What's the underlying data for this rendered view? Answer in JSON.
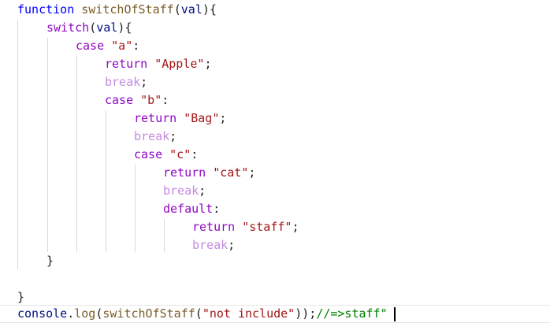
{
  "editor": {
    "lines": [
      {
        "tokens": [
          [
            "kw",
            "function"
          ],
          [
            "plain",
            " "
          ],
          [
            "fn",
            "switchOfStaff"
          ],
          [
            "plain",
            "("
          ],
          [
            "ident",
            "val"
          ],
          [
            "plain",
            "){"
          ]
        ]
      },
      {
        "tokens": [
          [
            "ctrl",
            "switch"
          ],
          [
            "plain",
            "("
          ],
          [
            "ident",
            "val"
          ],
          [
            "plain",
            "){"
          ]
        ]
      },
      {
        "tokens": [
          [
            "ctrl",
            "case"
          ],
          [
            "plain",
            " "
          ],
          [
            "str",
            "\"a\""
          ],
          [
            "plain",
            ":"
          ]
        ]
      },
      {
        "tokens": [
          [
            "ctrl",
            "return"
          ],
          [
            "plain",
            " "
          ],
          [
            "str",
            "\"Apple\""
          ],
          [
            "plain",
            ";"
          ]
        ]
      },
      {
        "tokens": [
          [
            "ctrl-dim",
            "break"
          ],
          [
            "plain",
            ";"
          ]
        ]
      },
      {
        "tokens": [
          [
            "ctrl",
            "case"
          ],
          [
            "plain",
            " "
          ],
          [
            "str",
            "\"b\""
          ],
          [
            "plain",
            ":"
          ]
        ]
      },
      {
        "tokens": [
          [
            "ctrl",
            "return"
          ],
          [
            "plain",
            " "
          ],
          [
            "str",
            "\"Bag\""
          ],
          [
            "plain",
            ";"
          ]
        ]
      },
      {
        "tokens": [
          [
            "ctrl-dim",
            "break"
          ],
          [
            "plain",
            ";"
          ]
        ]
      },
      {
        "tokens": [
          [
            "ctrl",
            "case"
          ],
          [
            "plain",
            " "
          ],
          [
            "str",
            "\"c\""
          ],
          [
            "plain",
            ":"
          ]
        ]
      },
      {
        "tokens": [
          [
            "ctrl",
            "return"
          ],
          [
            "plain",
            " "
          ],
          [
            "str",
            "\"cat\""
          ],
          [
            "plain",
            ";"
          ]
        ]
      },
      {
        "tokens": [
          [
            "ctrl-dim",
            "break"
          ],
          [
            "plain",
            ";"
          ]
        ]
      },
      {
        "tokens": [
          [
            "ctrl",
            "default"
          ],
          [
            "plain",
            ":"
          ]
        ]
      },
      {
        "tokens": [
          [
            "ctrl",
            "return"
          ],
          [
            "plain",
            " "
          ],
          [
            "str",
            "\"staff\""
          ],
          [
            "plain",
            ";"
          ]
        ]
      },
      {
        "tokens": [
          [
            "ctrl-dim",
            "break"
          ],
          [
            "plain",
            ";"
          ]
        ]
      },
      {
        "tokens": [
          [
            "plain",
            "}"
          ]
        ]
      },
      {
        "tokens": []
      },
      {
        "tokens": [
          [
            "plain",
            "}"
          ]
        ]
      },
      {
        "tokens": [
          [
            "ident",
            "console"
          ],
          [
            "plain",
            "."
          ],
          [
            "fn",
            "log"
          ],
          [
            "plain",
            "("
          ],
          [
            "fn",
            "switchOfStaff"
          ],
          [
            "plain",
            "("
          ],
          [
            "str",
            "\"not include\""
          ],
          [
            "plain",
            "));"
          ],
          [
            "comment",
            "//=>staff\""
          ]
        ]
      }
    ]
  }
}
